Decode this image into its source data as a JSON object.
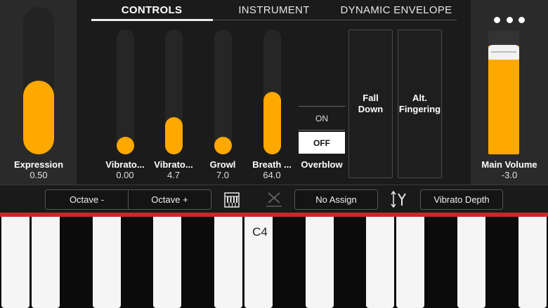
{
  "tabs": [
    {
      "label": "CONTROLS",
      "active": true
    },
    {
      "label": "INSTRUMENT",
      "active": false
    },
    {
      "label": "DYNAMIC ENVELOPE",
      "active": false
    }
  ],
  "expression": {
    "label": "Expression",
    "value": "0.50",
    "level": 0.5
  },
  "sliders": [
    {
      "label": "Vibrato...",
      "value": "0.00",
      "level": 0.0
    },
    {
      "label": "Vibrato...",
      "value": "4.7",
      "level": 0.3
    },
    {
      "label": "Growl",
      "value": "7.0",
      "level": 0.0
    },
    {
      "label": "Breath ...",
      "value": "64.0",
      "level": 0.5
    }
  ],
  "overblow": {
    "label": "Overblow",
    "on_label": "ON",
    "off_label": "OFF",
    "selected": "OFF"
  },
  "pads": {
    "fall_down": "Fall Down",
    "alt_line1": "Alt.",
    "alt_line2": "Fingering"
  },
  "main_volume": {
    "label": "Main Volume",
    "value": "-3.0",
    "level": 0.88
  },
  "toolbar": {
    "octave_minus": "Octave -",
    "octave_plus": "Octave +",
    "assign": "No Assign",
    "target": "Vibrato Depth"
  },
  "keyboard": {
    "label": "C4"
  },
  "colors": {
    "accent": "#ffa800",
    "red_bar": "#c52a2a"
  },
  "icons": {
    "menu": "more-dots-icon",
    "keys": "keyboard-icon",
    "cross": "close-icon",
    "axis": "vertical-axis-icon"
  }
}
